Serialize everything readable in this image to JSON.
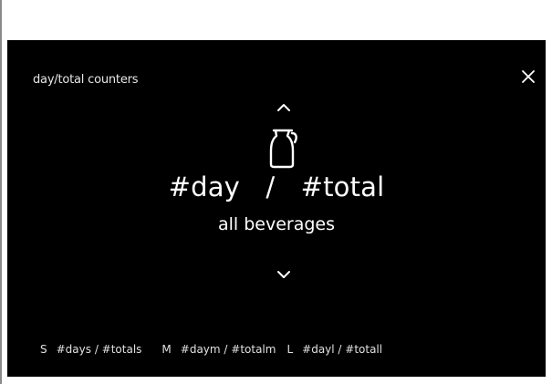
{
  "screen": {
    "title": "day/total counters",
    "close_icon": "close-icon",
    "up_icon": "chevron-up-icon",
    "down_icon": "chevron-down-icon",
    "beverage_icon": "coffee-jug-icon",
    "counter": {
      "day": "#day",
      "separator": "/",
      "total": "#total"
    },
    "beverage_label": "all beverages",
    "sizes": [
      {
        "letter": "S",
        "value": "#days / #totals"
      },
      {
        "letter": "M",
        "value": "#daym / #totalm"
      },
      {
        "letter": "L",
        "value": "#dayl / #totall"
      }
    ]
  }
}
